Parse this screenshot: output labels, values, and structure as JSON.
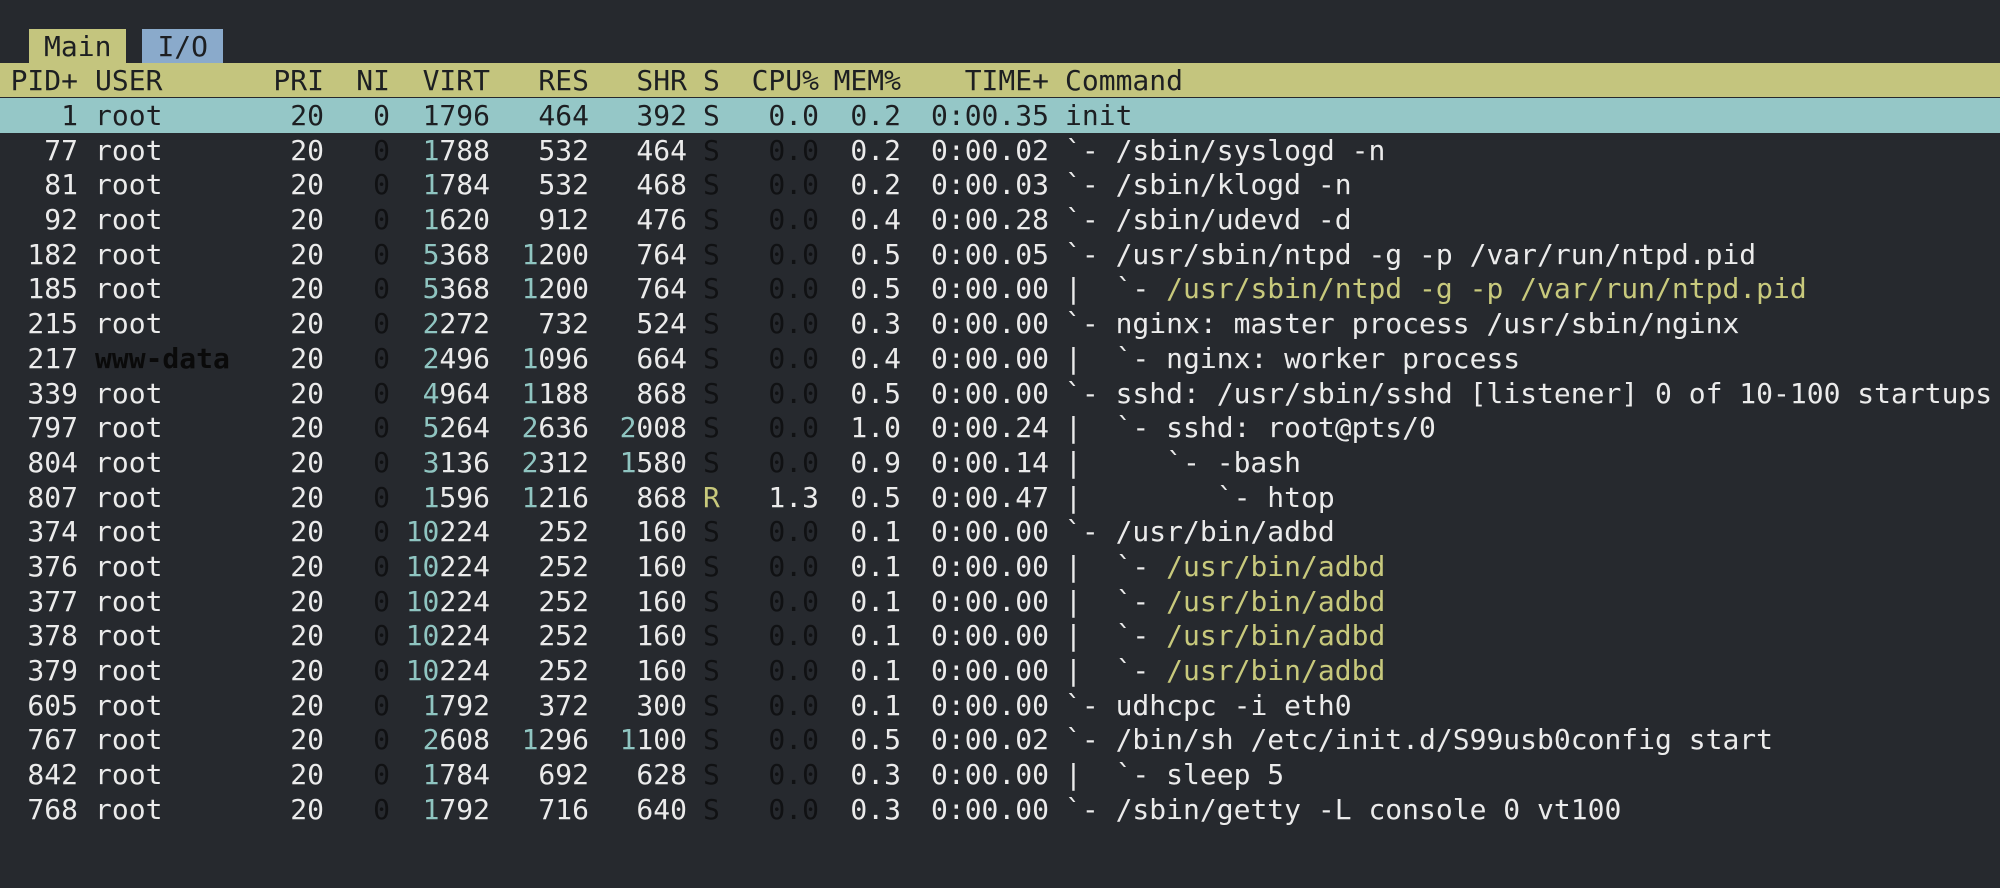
{
  "tabs": [
    {
      "label": "Main",
      "active": true
    },
    {
      "label": "I/O",
      "active": false
    }
  ],
  "header": {
    "pid": "PID+",
    "user": "USER",
    "pri": "PRI",
    "ni": "NI",
    "virt": "VIRT",
    "res": "RES",
    "shr": "SHR",
    "s": "S",
    "cpu": "CPU%",
    "mem": "MEM%",
    "time": "TIME+",
    "command": "Command"
  },
  "colors": {
    "background": "#26292e",
    "header_bg": "#c4c57e",
    "selected_bg": "#95c7c7",
    "active_tab_bg": "#c4c57e",
    "inactive_tab_bg": "#8aaacb",
    "thread_color": "#c8c97c",
    "highlight_digits": "#8fc5c1"
  },
  "processes": [
    {
      "pid": "1",
      "user": "root",
      "pri": "20",
      "ni": "0",
      "virt": "1796",
      "res": "464",
      "shr": "392",
      "s": "S",
      "cpu": "0.0",
      "mem": "0.2",
      "time": "0:00.35",
      "tree": "",
      "cmd": "init",
      "thread": false
    },
    {
      "pid": "77",
      "user": "root",
      "pri": "20",
      "ni": "0",
      "virt": "1788",
      "res": "532",
      "shr": "464",
      "s": "S",
      "cpu": "0.0",
      "mem": "0.2",
      "time": "0:00.02",
      "tree": "`- ",
      "cmd": "/sbin/syslogd -n",
      "thread": false
    },
    {
      "pid": "81",
      "user": "root",
      "pri": "20",
      "ni": "0",
      "virt": "1784",
      "res": "532",
      "shr": "468",
      "s": "S",
      "cpu": "0.0",
      "mem": "0.2",
      "time": "0:00.03",
      "tree": "`- ",
      "cmd": "/sbin/klogd -n",
      "thread": false
    },
    {
      "pid": "92",
      "user": "root",
      "pri": "20",
      "ni": "0",
      "virt": "1620",
      "res": "912",
      "shr": "476",
      "s": "S",
      "cpu": "0.0",
      "mem": "0.4",
      "time": "0:00.28",
      "tree": "`- ",
      "cmd": "/sbin/udevd -d",
      "thread": false
    },
    {
      "pid": "182",
      "user": "root",
      "pri": "20",
      "ni": "0",
      "virt": "5368",
      "res": "1200",
      "shr": "764",
      "s": "S",
      "cpu": "0.0",
      "mem": "0.5",
      "time": "0:00.05",
      "tree": "`- ",
      "cmd": "/usr/sbin/ntpd -g -p /var/run/ntpd.pid",
      "thread": false
    },
    {
      "pid": "185",
      "user": "root",
      "pri": "20",
      "ni": "0",
      "virt": "5368",
      "res": "1200",
      "shr": "764",
      "s": "S",
      "cpu": "0.0",
      "mem": "0.5",
      "time": "0:00.00",
      "tree": "|  `- ",
      "cmd": "/usr/sbin/ntpd -g -p /var/run/ntpd.pid",
      "thread": true
    },
    {
      "pid": "215",
      "user": "root",
      "pri": "20",
      "ni": "0",
      "virt": "2272",
      "res": "732",
      "shr": "524",
      "s": "S",
      "cpu": "0.0",
      "mem": "0.3",
      "time": "0:00.00",
      "tree": "`- ",
      "cmd": "nginx: master process /usr/sbin/nginx",
      "thread": false
    },
    {
      "pid": "217",
      "user": "www-data",
      "pri": "20",
      "ni": "0",
      "virt": "2496",
      "res": "1096",
      "shr": "664",
      "s": "S",
      "cpu": "0.0",
      "mem": "0.4",
      "time": "0:00.00",
      "tree": "|  `- ",
      "cmd": "nginx: worker process",
      "thread": false
    },
    {
      "pid": "339",
      "user": "root",
      "pri": "20",
      "ni": "0",
      "virt": "4964",
      "res": "1188",
      "shr": "868",
      "s": "S",
      "cpu": "0.0",
      "mem": "0.5",
      "time": "0:00.00",
      "tree": "`- ",
      "cmd": "sshd: /usr/sbin/sshd [listener] 0 of 10-100 startups",
      "thread": false
    },
    {
      "pid": "797",
      "user": "root",
      "pri": "20",
      "ni": "0",
      "virt": "5264",
      "res": "2636",
      "shr": "2008",
      "s": "S",
      "cpu": "0.0",
      "mem": "1.0",
      "time": "0:00.24",
      "tree": "|  `- ",
      "cmd": "sshd: root@pts/0",
      "thread": false
    },
    {
      "pid": "804",
      "user": "root",
      "pri": "20",
      "ni": "0",
      "virt": "3136",
      "res": "2312",
      "shr": "1580",
      "s": "S",
      "cpu": "0.0",
      "mem": "0.9",
      "time": "0:00.14",
      "tree": "|     `- ",
      "cmd": "-bash",
      "thread": false
    },
    {
      "pid": "807",
      "user": "root",
      "pri": "20",
      "ni": "0",
      "virt": "1596",
      "res": "1216",
      "shr": "868",
      "s": "R",
      "cpu": "1.3",
      "mem": "0.5",
      "time": "0:00.47",
      "tree": "|        `- ",
      "cmd": "htop",
      "thread": false
    },
    {
      "pid": "374",
      "user": "root",
      "pri": "20",
      "ni": "0",
      "virt": "10224",
      "res": "252",
      "shr": "160",
      "s": "S",
      "cpu": "0.0",
      "mem": "0.1",
      "time": "0:00.00",
      "tree": "`- ",
      "cmd": "/usr/bin/adbd",
      "thread": false
    },
    {
      "pid": "376",
      "user": "root",
      "pri": "20",
      "ni": "0",
      "virt": "10224",
      "res": "252",
      "shr": "160",
      "s": "S",
      "cpu": "0.0",
      "mem": "0.1",
      "time": "0:00.00",
      "tree": "|  `- ",
      "cmd": "/usr/bin/adbd",
      "thread": true
    },
    {
      "pid": "377",
      "user": "root",
      "pri": "20",
      "ni": "0",
      "virt": "10224",
      "res": "252",
      "shr": "160",
      "s": "S",
      "cpu": "0.0",
      "mem": "0.1",
      "time": "0:00.00",
      "tree": "|  `- ",
      "cmd": "/usr/bin/adbd",
      "thread": true
    },
    {
      "pid": "378",
      "user": "root",
      "pri": "20",
      "ni": "0",
      "virt": "10224",
      "res": "252",
      "shr": "160",
      "s": "S",
      "cpu": "0.0",
      "mem": "0.1",
      "time": "0:00.00",
      "tree": "|  `- ",
      "cmd": "/usr/bin/adbd",
      "thread": true
    },
    {
      "pid": "379",
      "user": "root",
      "pri": "20",
      "ni": "0",
      "virt": "10224",
      "res": "252",
      "shr": "160",
      "s": "S",
      "cpu": "0.0",
      "mem": "0.1",
      "time": "0:00.00",
      "tree": "|  `- ",
      "cmd": "/usr/bin/adbd",
      "thread": true
    },
    {
      "pid": "605",
      "user": "root",
      "pri": "20",
      "ni": "0",
      "virt": "1792",
      "res": "372",
      "shr": "300",
      "s": "S",
      "cpu": "0.0",
      "mem": "0.1",
      "time": "0:00.00",
      "tree": "`- ",
      "cmd": "udhcpc -i eth0",
      "thread": false
    },
    {
      "pid": "767",
      "user": "root",
      "pri": "20",
      "ni": "0",
      "virt": "2608",
      "res": "1296",
      "shr": "1100",
      "s": "S",
      "cpu": "0.0",
      "mem": "0.5",
      "time": "0:00.02",
      "tree": "`- ",
      "cmd": "/bin/sh /etc/init.d/S99usb0config start",
      "thread": false
    },
    {
      "pid": "842",
      "user": "root",
      "pri": "20",
      "ni": "0",
      "virt": "1784",
      "res": "692",
      "shr": "628",
      "s": "S",
      "cpu": "0.0",
      "mem": "0.3",
      "time": "0:00.00",
      "tree": "|  `- ",
      "cmd": "sleep 5",
      "thread": false
    },
    {
      "pid": "768",
      "user": "root",
      "pri": "20",
      "ni": "0",
      "virt": "1792",
      "res": "716",
      "shr": "640",
      "s": "S",
      "cpu": "0.0",
      "mem": "0.3",
      "time": "0:00.00",
      "tree": "`- ",
      "cmd": "/sbin/getty -L console 0 vt100",
      "thread": false
    }
  ],
  "selected_index": 0
}
